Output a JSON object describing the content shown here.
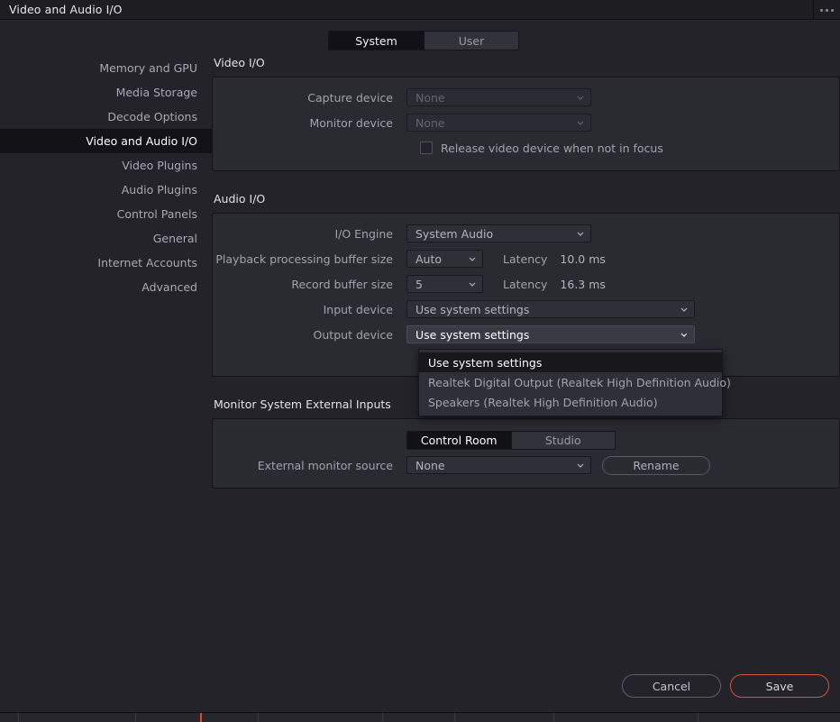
{
  "window": {
    "title": "Video and Audio I/O",
    "overflow_icon": "more-options-icon"
  },
  "top_tabs": [
    {
      "label": "System",
      "active": true
    },
    {
      "label": "User",
      "active": false
    }
  ],
  "sidebar": {
    "items": [
      {
        "label": "Memory and GPU",
        "active": false
      },
      {
        "label": "Media Storage",
        "active": false
      },
      {
        "label": "Decode Options",
        "active": false
      },
      {
        "label": "Video and Audio I/O",
        "active": true
      },
      {
        "label": "Video Plugins",
        "active": false
      },
      {
        "label": "Audio Plugins",
        "active": false
      },
      {
        "label": "Control Panels",
        "active": false
      },
      {
        "label": "General",
        "active": false
      },
      {
        "label": "Internet Accounts",
        "active": false
      },
      {
        "label": "Advanced",
        "active": false
      }
    ]
  },
  "video_io": {
    "title": "Video I/O",
    "capture_device": {
      "label": "Capture device",
      "value": "None"
    },
    "monitor_device": {
      "label": "Monitor device",
      "value": "None"
    },
    "release_checkbox": {
      "label": "Release video device when not in focus",
      "checked": false
    }
  },
  "audio_io": {
    "title": "Audio I/O",
    "io_engine": {
      "label": "I/O Engine",
      "value": "System Audio"
    },
    "playback_buffer": {
      "label": "Playback processing buffer size",
      "value": "Auto",
      "latency_label": "Latency",
      "latency_value": "10.0 ms"
    },
    "record_buffer": {
      "label": "Record buffer size",
      "value": "5",
      "latency_label": "Latency",
      "latency_value": "16.3 ms"
    },
    "input_device": {
      "label": "Input device",
      "value": "Use system settings"
    },
    "output_device": {
      "label": "Output device",
      "value": "Use system settings"
    },
    "output_dropdown": {
      "open": true,
      "options": [
        {
          "label": "Use system settings",
          "selected": true
        },
        {
          "label": "Realtek Digital Output (Realtek High Definition Audio)",
          "selected": false
        },
        {
          "label": "Speakers (Realtek High Definition Audio)",
          "selected": false
        }
      ]
    }
  },
  "monitor_external": {
    "title": "Monitor System External Inputs",
    "tabs": [
      {
        "label": "Control Room",
        "active": true
      },
      {
        "label": "Studio",
        "active": false
      }
    ],
    "external_monitor_source": {
      "label": "External monitor source",
      "value": "None"
    },
    "rename_button": "Rename"
  },
  "footer": {
    "cancel": "Cancel",
    "save": "Save"
  },
  "colors": {
    "accent_red": "#d9503c",
    "panel_bg": "#2a2a31",
    "window_bg": "#232329",
    "active_sidebar_bg": "#131317",
    "playhead_red": "#e0462c"
  }
}
